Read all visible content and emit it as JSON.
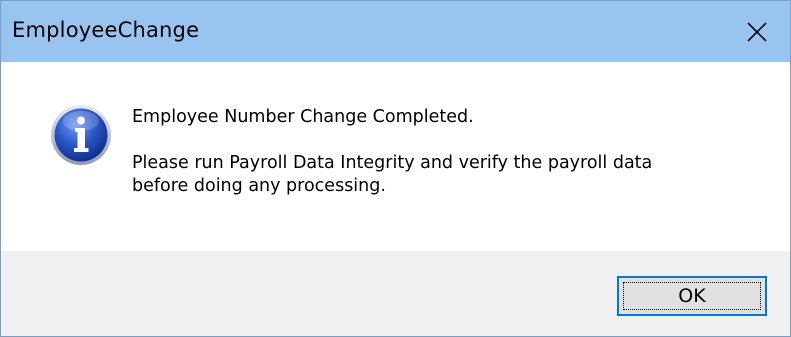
{
  "dialog": {
    "title": "EmployeeChange",
    "icon": "info-icon",
    "message_line1": "Employee Number Change Completed.",
    "message_line2": "Please run Payroll Data Integrity and verify the payroll data",
    "message_line3": "before doing any processing.",
    "ok_label": "OK"
  },
  "colors": {
    "titlebar": "#99c4f0",
    "footer": "#f0f0f0",
    "button_border": "#0078d7",
    "icon_blue": "#2a56c6"
  }
}
